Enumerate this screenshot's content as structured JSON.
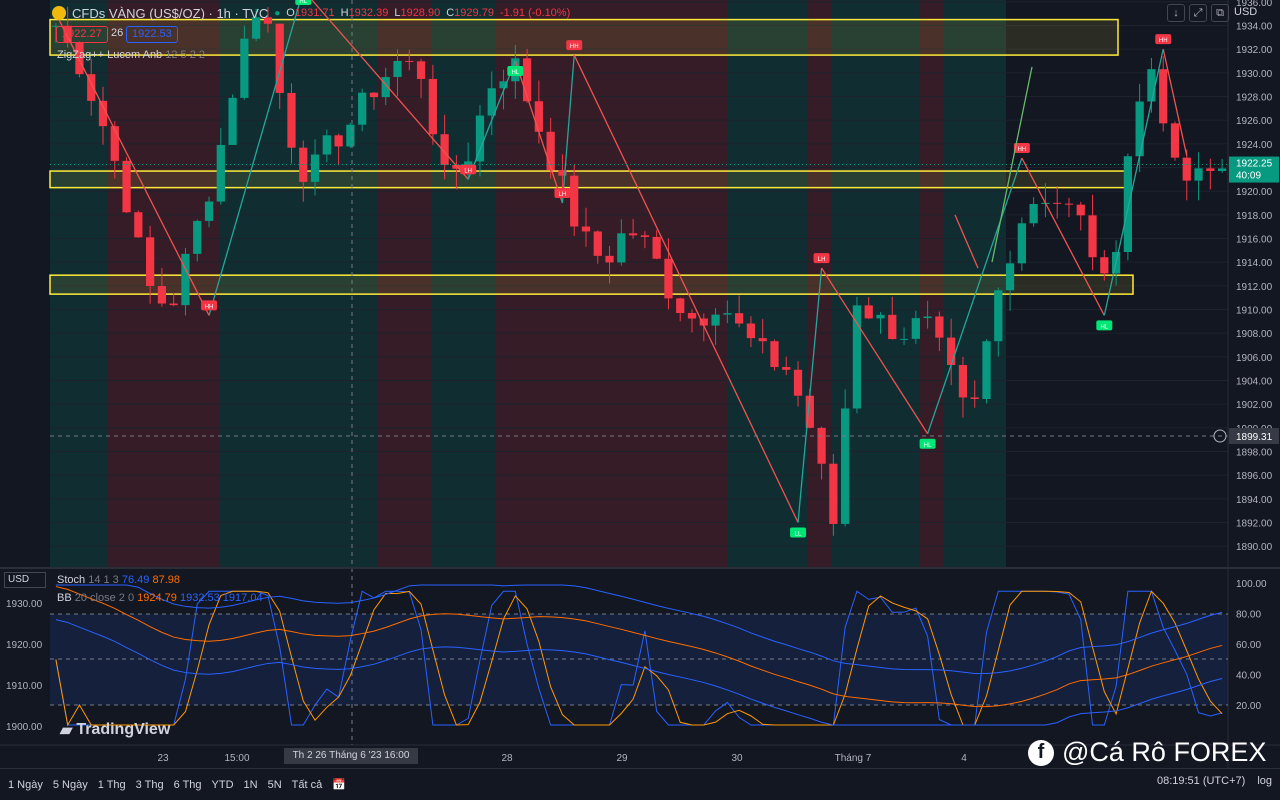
{
  "header": {
    "symbol": "CFDs VÀNG (US$/OZ) · 1h · TVC",
    "open_label": "O",
    "open": "1931.71",
    "high_label": "H",
    "high": "1932.39",
    "low_label": "L",
    "low": "1928.90",
    "close_label": "C",
    "close": "1929.79",
    "change": "-1.91 (-0.10%)",
    "bid": "1922.27",
    "spread": "26",
    "ask": "1922.53"
  },
  "indicators": {
    "zigzag_name": "ZigZag++ Lucem Anb",
    "zigzag_params": "12 5 2 2",
    "stoch_name": "Stoch",
    "stoch_params": "14 1 3",
    "stoch_k": "76.49",
    "stoch_d": "87.98",
    "bb_name": "BB",
    "bb_params": "20 close 2 0",
    "bb_basis": "1924.79",
    "bb_upper": "1932.53",
    "bb_lower": "1917.04"
  },
  "toolbar": {
    "currency": "USD",
    "lower_currency": "USD"
  },
  "timeframes": [
    "1 Ngày",
    "5 Ngày",
    "1 Thg",
    "3 Thg",
    "6 Thg",
    "YTD",
    "1N",
    "5N",
    "Tất cả"
  ],
  "status": {
    "clock": "08:19:51 (UTC+7)",
    "log": "log"
  },
  "crosshair_time": "Th 2 26 Tháng 6 '23   16:00",
  "watermark": "TradingView",
  "brand": "@Cá Rô FOREX",
  "colors": {
    "bull": "#089981",
    "bear": "#f23645",
    "zone": "#ffeb3b",
    "zigzag_up": "#26a69a",
    "zigzag_down": "#ef5350"
  },
  "chart_data": {
    "type": "candlestick",
    "price_axis": {
      "ticks": [
        1890,
        1892,
        1894,
        1896,
        1898,
        1900,
        1902,
        1904,
        1906,
        1908,
        1910,
        1912,
        1914,
        1916,
        1918,
        1920,
        1922,
        1924,
        1926,
        1928,
        1930,
        1932,
        1934,
        1936
      ],
      "ylim": [
        1889,
        1937
      ],
      "current_price": "1922.25",
      "countdown": "40:09",
      "crosshair_price": "1899.31"
    },
    "x_ticks": [
      "23",
      "15:00",
      "28",
      "29",
      "30",
      "Tháng 7",
      "4"
    ],
    "close_path": [
      1934,
      1931,
      1926,
      1920,
      1912,
      1910,
      1916,
      1922,
      1931,
      1937,
      1926,
      1921,
      1924,
      1926,
      1929,
      1931,
      1930,
      1921,
      1923,
      1929,
      1931,
      1926,
      1921,
      1916,
      1914,
      1917,
      1915,
      1911,
      1909,
      1911,
      1908,
      1906,
      1905,
      1900,
      1892,
      1911,
      1909,
      1908,
      1909,
      1905,
      1900,
      1910,
      1917,
      1920,
      1919,
      1917,
      1911,
      1925,
      1931,
      1921,
      1921,
      1922
    ],
    "zones": [
      [
        1931.5,
        1934.5
      ],
      [
        1920.3,
        1921.7
      ],
      [
        1911.3,
        1912.9
      ]
    ],
    "zigzag": [
      [
        0,
        1935
      ],
      [
        13,
        1909.5
      ],
      [
        21,
        1937
      ],
      [
        35,
        1921
      ],
      [
        39,
        1931
      ],
      [
        43,
        1919
      ],
      [
        44,
        1931.5
      ],
      [
        63,
        1892
      ],
      [
        65,
        1913.5
      ],
      [
        74,
        1899.5
      ],
      [
        82,
        1922.8
      ],
      [
        89,
        1909.5
      ],
      [
        94,
        1932
      ],
      [
        96,
        1923
      ]
    ],
    "pivot_labels": [
      "HH",
      "HL",
      "LH",
      "HL",
      "LH",
      "HH",
      "LL",
      "LH",
      "HL",
      "HH",
      "HL",
      "HH"
    ],
    "stoch_levels": [
      80,
      50,
      20
    ],
    "stoch_axis": [
      "100.00",
      "80.00",
      "60.00",
      "40.00",
      "20.00"
    ],
    "bb_axis": [
      "1930.00",
      "1920.00",
      "1910.00",
      "1900.00"
    ]
  }
}
